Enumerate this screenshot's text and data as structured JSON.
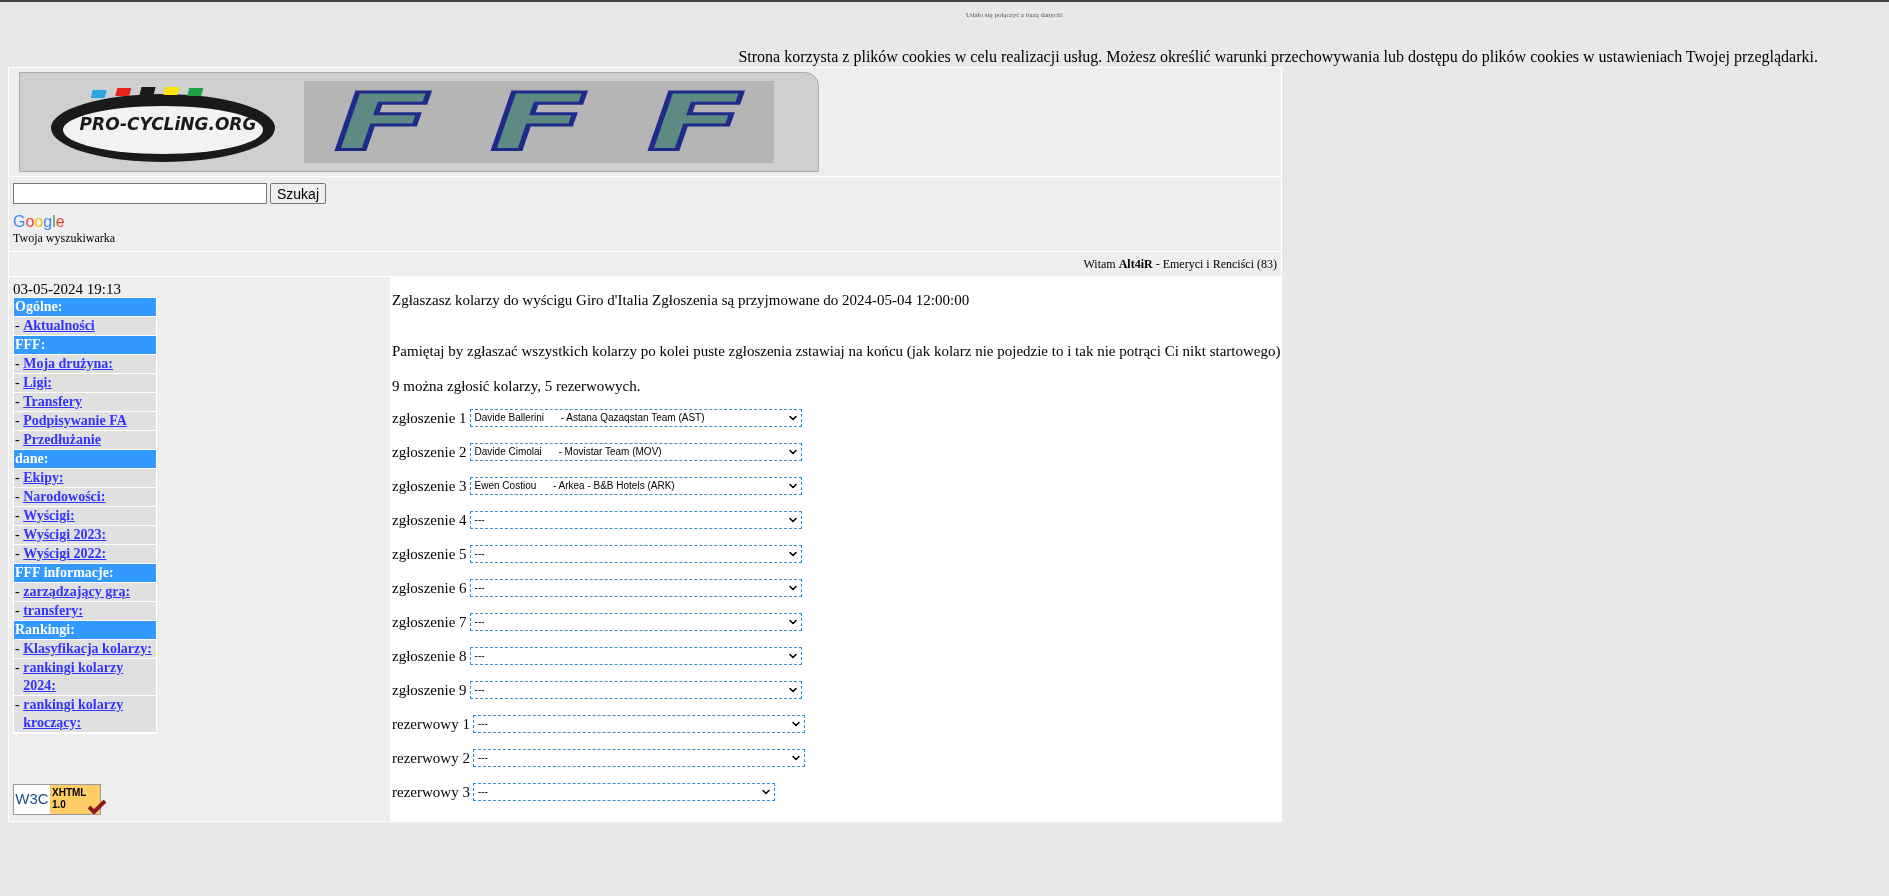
{
  "status_message": "Udało się połączyć z bazą danych!",
  "cookie_notice": "Strona korzysta z plików cookies w celu realizacji usług. Możesz określić warunki przechowywania lub dostępu do plików cookies w ustawieniach Twojej przeglądarki.",
  "banner": {
    "logo_text": "PRO-CYCLiNG.ORG",
    "letters": [
      "F",
      "F",
      "F"
    ]
  },
  "search": {
    "button": "Szukaj",
    "brand": "Google",
    "caption": "Twoja wyszukiwarka"
  },
  "welcome": {
    "greeting": "Witam",
    "user": "Alt4iR",
    "team": "- Emeryci i Renciści (83)"
  },
  "sidebar": {
    "datetime": "03-05-2024 19:13",
    "bullet": "-",
    "sections": [
      {
        "title": "Ogólne:",
        "items": [
          "Aktualności"
        ]
      },
      {
        "title": "FFF:",
        "items": [
          "Moja drużyna:",
          "Ligi:",
          "Transfery",
          "Podpisywanie FA",
          "Przedłużanie"
        ]
      },
      {
        "title": "dane:",
        "items": [
          "Ekipy:",
          "Narodowości:",
          "Wyścigi:",
          "Wyścigi 2023:",
          "Wyścigi 2022:"
        ]
      },
      {
        "title": "FFF informacje:",
        "items": [
          "zarządzający grą:",
          "transfery:"
        ]
      },
      {
        "title": "Rankingi:",
        "items": [
          "Klasyfikacja kolarzy:",
          "rankingi kolarzy 2024:",
          "rankingi kolarzy kroczący:"
        ]
      }
    ],
    "badge": {
      "w3c": "W3C",
      "standard": "XHTML",
      "version": "1.0"
    }
  },
  "content": {
    "intro": "Zgłaszasz kolarzy do wyścigu Giro d'Italia Zgłoszenia są przyjmowane do 2024-05-04 12:00:00",
    "reminder": "Pamiętaj by zgłaszać wszystkich kolarzy po kolei puste zgłoszenia zstawiaj na końcu (jak kolarz nie pojedzie to i tak nie potrąci Ci nikt startowego)",
    "limits": "9 można zgłosić kolarzy, 5 rezerwowych.",
    "entries": [
      {
        "label": "zgłoszenie 1",
        "rider": "Davide Ballerini",
        "team": "- Astana Qazaqstan Team (AST)"
      },
      {
        "label": "zgłoszenie 2",
        "rider": "Davide Cimolai",
        "team": "- Movistar Team (MOV)"
      },
      {
        "label": "zgłoszenie 3",
        "rider": "Ewen Costiou",
        "team": "- Arkea - B&B Hotels (ARK)"
      },
      {
        "label": "zgłoszenie 4",
        "rider": "---"
      },
      {
        "label": "zgłoszenie 5",
        "rider": "---"
      },
      {
        "label": "zgłoszenie 6",
        "rider": "---"
      },
      {
        "label": "zgłoszenie 7",
        "rider": "---"
      },
      {
        "label": "zgłoszenie 8",
        "rider": "---"
      },
      {
        "label": "zgłoszenie 9",
        "rider": "---"
      },
      {
        "label": "rezerwowy 1",
        "rider": "---"
      },
      {
        "label": "rezerwowy 2",
        "rider": "---"
      },
      {
        "label": "rezerwowy 3",
        "rider": "---",
        "kind": "narrow"
      }
    ]
  }
}
